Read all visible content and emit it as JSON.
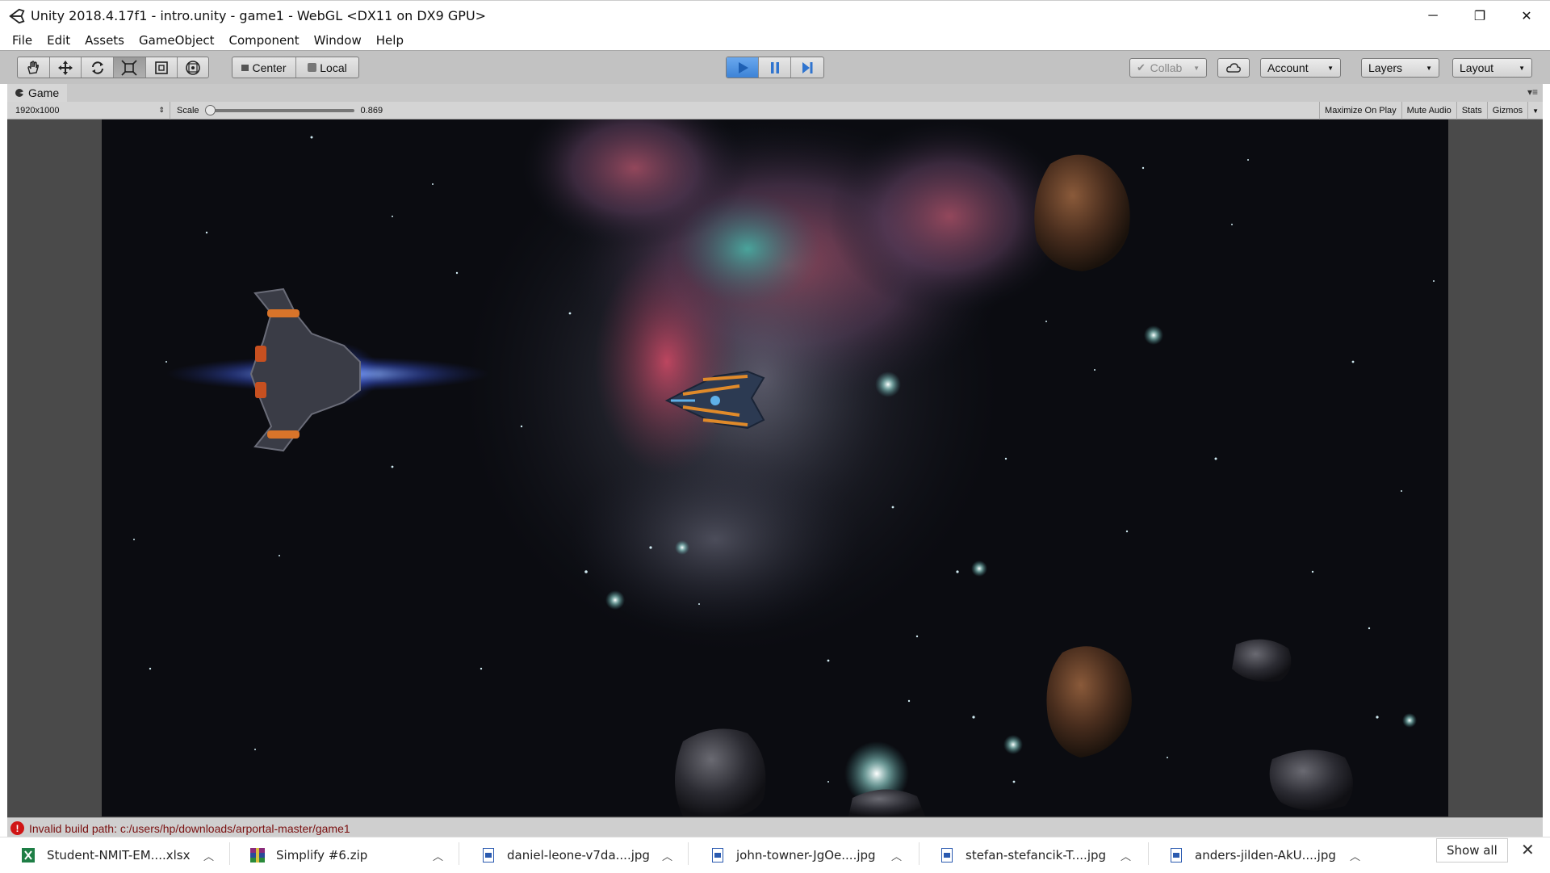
{
  "window": {
    "title": "Unity 2018.4.17f1 - intro.unity - game1 - WebGL <DX11 on DX9 GPU>",
    "minimize": "─",
    "restore": "❐",
    "close": "✕"
  },
  "menu": [
    "File",
    "Edit",
    "Assets",
    "GameObject",
    "Component",
    "Window",
    "Help"
  ],
  "toolbar": {
    "tools": [
      {
        "name": "hand-tool-icon",
        "glyph": "✋",
        "selected": false
      },
      {
        "name": "move-tool-icon",
        "glyph": "✥",
        "selected": false
      },
      {
        "name": "rotate-tool-icon",
        "glyph": "⟳",
        "selected": false
      },
      {
        "name": "scale-tool-icon",
        "glyph": "⤢",
        "selected": true
      },
      {
        "name": "rect-tool-icon",
        "glyph": "⊡",
        "selected": false
      },
      {
        "name": "transform-tool-icon",
        "glyph": "⊛",
        "selected": false
      }
    ],
    "pivot_center": "Center",
    "pivot_local": "Local",
    "collab": "Collab",
    "account": "Account",
    "layers": "Layers",
    "layout": "Layout"
  },
  "game_panel": {
    "tab_label": "Game",
    "resolution": "1920x1000",
    "scale_label": "Scale",
    "scale_value": "0.869",
    "maximize_on_play": "Maximize On Play",
    "mute_audio": "Mute Audio",
    "stats": "Stats",
    "gizmos": "Gizmos"
  },
  "status": {
    "error_message": "Invalid build path: c:/users/hp/downloads/arportal-master/game1"
  },
  "downloads": {
    "items": [
      {
        "file": "Student-NMIT-EM....xlsx",
        "icon": "excel-file-icon"
      },
      {
        "file": "Simplify #6.zip",
        "icon": "zip-file-icon"
      },
      {
        "file": "daniel-leone-v7da....jpg",
        "icon": "image-file-icon"
      },
      {
        "file": "john-towner-JgOe....jpg",
        "icon": "image-file-icon"
      },
      {
        "file": "stefan-stefancik-T....jpg",
        "icon": "image-file-icon"
      },
      {
        "file": "anders-jilden-AkU....jpg",
        "icon": "image-file-icon"
      }
    ],
    "show_all": "Show all",
    "close": "✕"
  },
  "colors": {
    "play_active": "#3d83d6",
    "toolbar_bg": "#c2c2c2",
    "error_red": "#d01515",
    "space_bg": "#0b0c11",
    "nebula_pink": "#c7505e",
    "nebula_teal": "#3fa7a0"
  }
}
